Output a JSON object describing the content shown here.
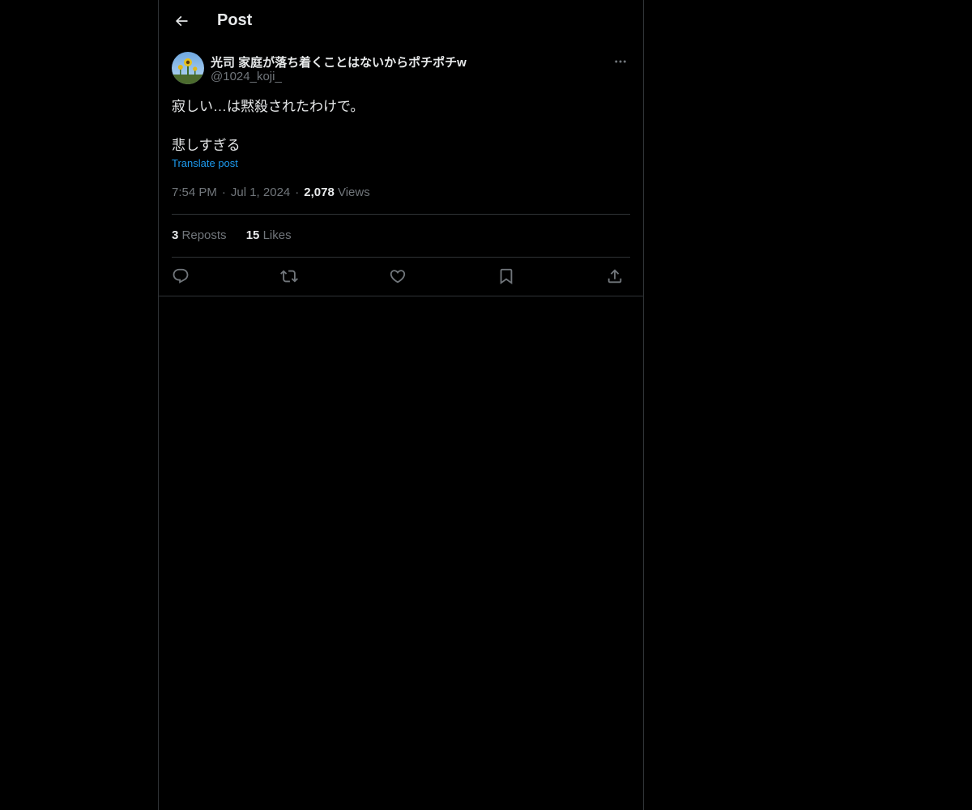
{
  "header": {
    "title": "Post",
    "back_icon": "arrow-left-icon"
  },
  "author": {
    "display_name": "光司 家庭が落ち着くことはないからポチポチw",
    "handle": "@1024_koji_",
    "avatar_icon": "avatar-photo"
  },
  "post": {
    "lines": [
      "寂しい…は黙殺されたわけで。",
      "",
      "悲しすぎる"
    ],
    "translate_label": "Translate post",
    "time": "7:54 PM",
    "date": "Jul 1, 2024",
    "separator": "·",
    "views_count": "2,078",
    "views_label": "Views"
  },
  "stats": {
    "reposts_count": "3",
    "reposts_label": "Reposts",
    "likes_count": "15",
    "likes_label": "Likes"
  },
  "actions": {
    "reply_icon": "reply-icon",
    "repost_icon": "repost-icon",
    "like_icon": "heart-icon",
    "bookmark_icon": "bookmark-icon",
    "share_icon": "share-icon"
  },
  "colors": {
    "background": "#000000",
    "text": "#e7e9ea",
    "muted": "#71767b",
    "accent": "#1d9bf0",
    "border": "#2f3336"
  }
}
